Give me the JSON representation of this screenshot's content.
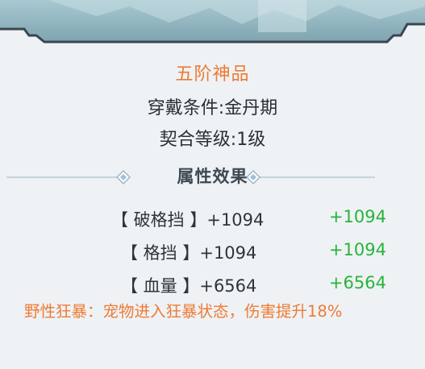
{
  "item": {
    "rank": "五阶神品",
    "wear_condition": "穿戴条件:金丹期",
    "bond_level": "契合等级:1级"
  },
  "attributes": {
    "title": "属性效果",
    "rows": [
      {
        "label": "【 破格挡 】+1094",
        "bonus": "+1094"
      },
      {
        "label": "【 格挡 】+1094",
        "bonus": "+1094"
      },
      {
        "label": "【 血量 】+6564",
        "bonus": "+6564"
      }
    ]
  },
  "special_effect": "野性狂暴：宠物进入狂暴状态，伤害提升18%",
  "colors": {
    "rank": "#f07a32",
    "bonus": "#29b33a",
    "effect": "#f07a32",
    "text": "#2c2f33"
  }
}
